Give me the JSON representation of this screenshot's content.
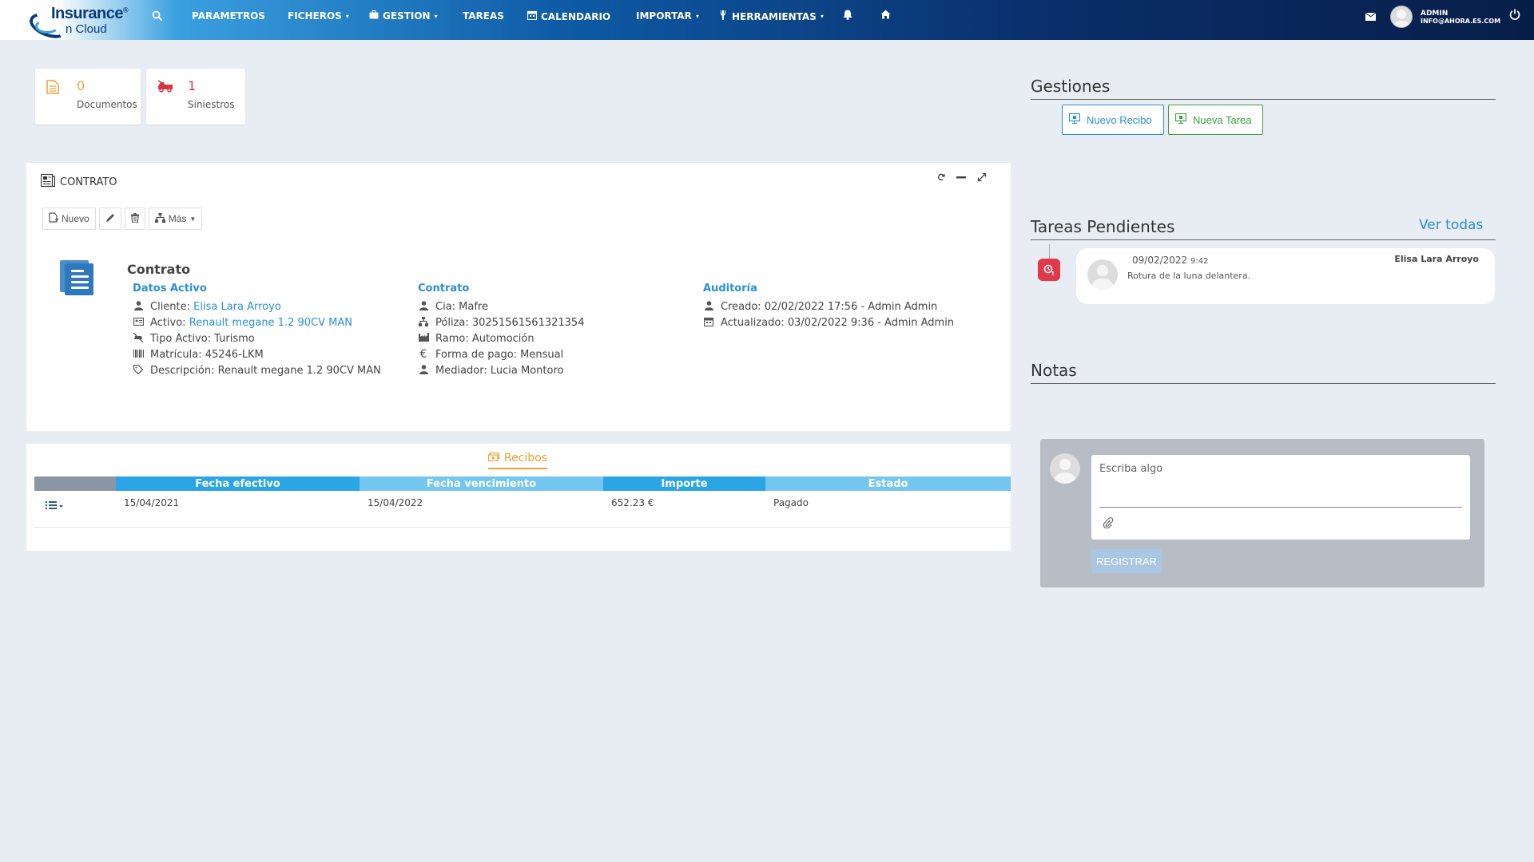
{
  "app": {
    "logo_line1": "Insurance",
    "logo_reg": "®",
    "logo_line2": "n Cloud"
  },
  "nav": {
    "items": [
      {
        "label": "PARAMETROS",
        "icon": "",
        "caret": ""
      },
      {
        "label": "FICHEROS",
        "icon": "",
        "caret": "▾"
      },
      {
        "label": "GESTION",
        "icon": "briefcase-icon",
        "caret": "▾"
      },
      {
        "label": "TAREAS",
        "icon": "",
        "caret": ""
      },
      {
        "label": "CALENDARIO",
        "icon": "calendar-icon",
        "caret": ""
      },
      {
        "label": "IMPORTAR",
        "icon": "",
        "caret": "▾"
      },
      {
        "label": "HERRAMIENTAS",
        "icon": "tools-icon",
        "caret": "▾"
      }
    ],
    "user_name": "ADMIN",
    "user_email": "INFO@AHORA.ES.COM"
  },
  "stats": [
    {
      "value": "0",
      "label": "Documentos",
      "color": "#f0a033",
      "icon": "document-icon"
    },
    {
      "value": "1",
      "label": "Siniestros",
      "color": "#d9363e",
      "icon": "tow-truck-icon"
    }
  ],
  "contrato": {
    "panel_title": "CONTRATO",
    "btn_nuevo": "Nuevo",
    "btn_mas": "Más",
    "section_title": "Contrato",
    "datos_activo": {
      "heading": "Datos Activo",
      "cliente_label": "Cliente:",
      "cliente_value": "Elisa Lara Arroyo",
      "activo_label": "Activo:",
      "activo_value": "Renault megane 1.2 90CV MAN",
      "tipo_activo": "Tipo Activo: Turismo",
      "matricula": "Matrícula: 45246-LKM",
      "descripcion": "Descripción: Renault megane 1.2 90CV MAN"
    },
    "contrato_col": {
      "heading": "Contrato",
      "cia": "Cia: Mafre",
      "poliza": "Póliza: 30251561561321354",
      "ramo": "Ramo: Automoción",
      "forma_pago": "Forma de pago: Mensual",
      "mediador": "Mediador: Lucia Montoro"
    },
    "auditoria": {
      "heading": "Auditoría",
      "creado": "Creado: 02/02/2022 17:56 - Admin Admin",
      "actualizado": "Actualizado: 03/02/2022 9:36 - Admin Admin"
    }
  },
  "recibos": {
    "tab_label": "Recibos",
    "columns": [
      "Fecha efectivo",
      "Fecha vencimiento",
      "Importe",
      "Estado"
    ],
    "rows": [
      {
        "fecha_efectivo": "15/04/2021",
        "fecha_vencimiento": "15/04/2022",
        "importe": "652.23 €",
        "estado": "Pagado"
      }
    ]
  },
  "gestiones": {
    "title": "Gestiones",
    "nuevo_recibo": "Nuevo Recibo",
    "nueva_tarea": "Nueva Tarea"
  },
  "tareas": {
    "title": "Tareas Pendientes",
    "ver_todas": "Ver todas",
    "items": [
      {
        "date": "09/02/2022",
        "time": "9:42",
        "user": "Elisa Lara Arroyo",
        "text": "Rotura de la luna delantera."
      }
    ]
  },
  "notas": {
    "title": "Notas",
    "placeholder": "Escriba algo",
    "register_label": "REGISTRAR"
  },
  "colors": {
    "accent_blue": "#2a8fd6",
    "orange": "#f0a033",
    "green": "#3aa23a",
    "red": "#e03a4a"
  }
}
